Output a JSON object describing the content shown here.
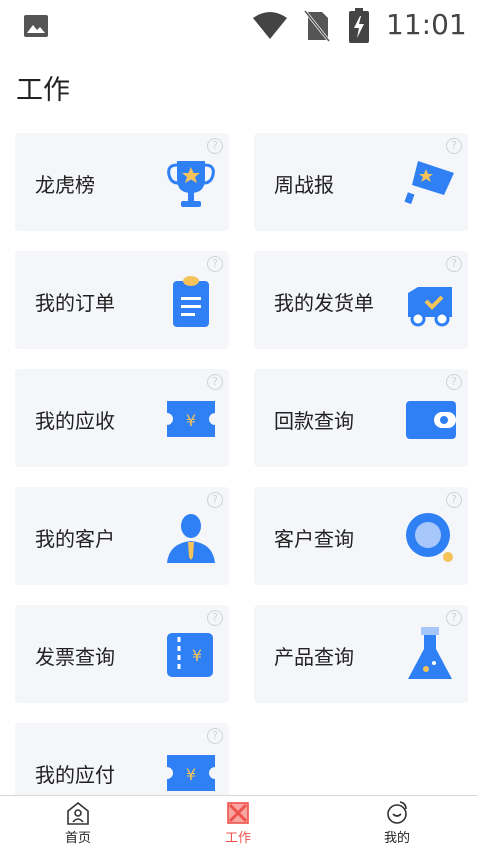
{
  "status_bar": {
    "time": "11:01"
  },
  "header": {
    "title": "工作"
  },
  "cards": [
    {
      "label": "龙虎榜",
      "icon": "trophy-icon"
    },
    {
      "label": "周战报",
      "icon": "flag-icon"
    },
    {
      "label": "我的订单",
      "icon": "clipboard-icon"
    },
    {
      "label": "我的发货单",
      "icon": "delivery-truck-icon"
    },
    {
      "label": "我的应收",
      "icon": "yuan-ticket-icon"
    },
    {
      "label": "回款查询",
      "icon": "wallet-icon"
    },
    {
      "label": "我的客户",
      "icon": "customer-icon"
    },
    {
      "label": "客户查询",
      "icon": "magnifier-icon"
    },
    {
      "label": "发票查询",
      "icon": "invoice-icon"
    },
    {
      "label": "产品查询",
      "icon": "flask-icon"
    },
    {
      "label": "我的应付",
      "icon": "yuan-ticket-icon"
    }
  ],
  "help_glyph": "?",
  "bottom_nav": {
    "home": "首页",
    "work": "工作",
    "mine": "我的"
  },
  "colors": {
    "accent": "#2f7ff5",
    "active_tab": "#f0524b",
    "card_bg": "#f4f6f9"
  }
}
